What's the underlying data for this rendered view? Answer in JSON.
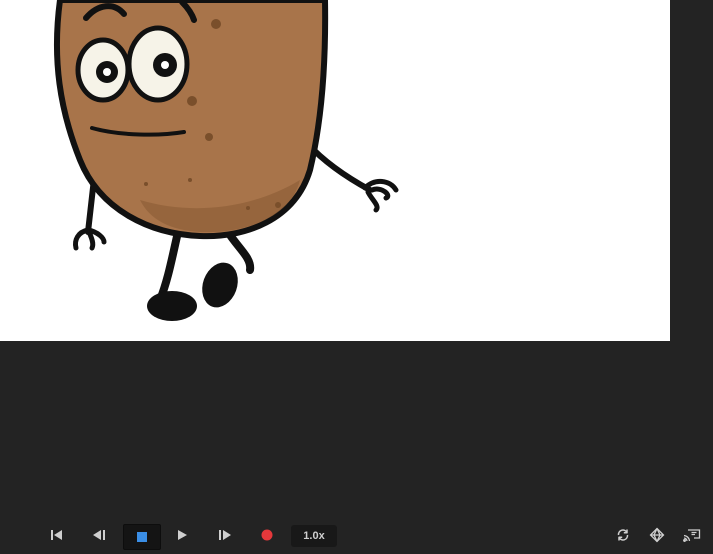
{
  "player": {
    "speed_label": "1.0x",
    "colors": {
      "background": "#232323",
      "stage": "#ffffff",
      "stop_accent": "#3a8ee6",
      "record_accent": "#e5383b",
      "icon": "#cfcfcf"
    }
  },
  "icons": {
    "first_frame": "skip-to-start-icon",
    "prev_frame": "step-back-icon",
    "stop": "stop-icon",
    "play": "play-icon",
    "next_frame": "step-forward-icon",
    "record": "record-icon",
    "loop": "loop-icon",
    "onion": "onion-skin-icon",
    "cast": "cast-icon"
  }
}
